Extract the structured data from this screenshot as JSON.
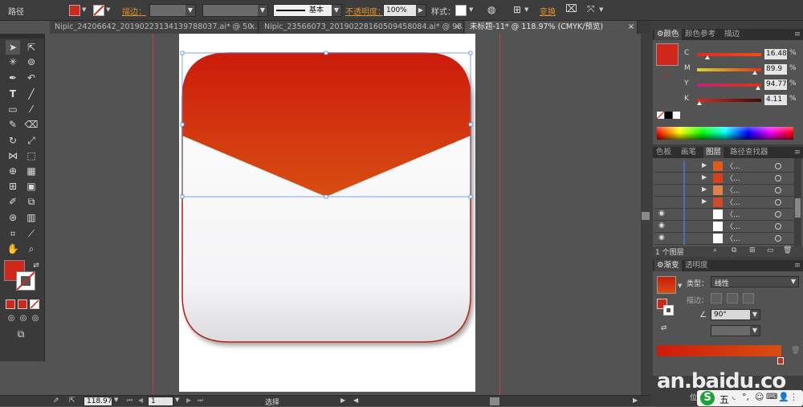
{
  "control_bar": {
    "object_label": "路径",
    "fill_color": "#d0271b",
    "stroke_label": "描边：",
    "stroke_profile": "基本",
    "opacity_label": "不透明度：",
    "opacity_value": "100%",
    "style_label": "样式：",
    "transform_label": "变换"
  },
  "tabs": [
    {
      "label": "Nipic_24206642_20190223134139788037.ai* @ 50...",
      "close": "×"
    },
    {
      "label": "Nipic_23566073_20190228160509458084.ai* @ 98...",
      "close": "×"
    },
    {
      "label": "未标题-11* @ 118.97% (CMYK/预览)",
      "close": "×"
    }
  ],
  "color_panel": {
    "tabs": [
      "颜色",
      "颜色参考",
      "描边"
    ],
    "sliders": [
      {
        "letter": "C",
        "value": "16.48",
        "unit": "%",
        "level": 0.16,
        "gradient": "linear-gradient(90deg,#e02a22,#f34c16)"
      },
      {
        "letter": "M",
        "value": "89.9",
        "unit": "%",
        "level": 0.9,
        "gradient": "linear-gradient(90deg,#d6d62c,#e03218)"
      },
      {
        "letter": "Y",
        "value": "94.77",
        "unit": "%",
        "level": 0.95,
        "gradient": "linear-gradient(90deg,#c1237c,#d93615)"
      },
      {
        "letter": "K",
        "value": "4.11",
        "unit": "%",
        "level": 0.04,
        "gradient": "linear-gradient(90deg,#dd2a1c,#3a0c09)"
      }
    ]
  },
  "layers_panel": {
    "tabs": [
      "色板",
      "画笔",
      "图层",
      "路径查找器"
    ],
    "rows": [
      {
        "eye": "",
        "arrow": "▶",
        "name": "〈...",
        "thumb": "#e05a1c"
      },
      {
        "eye": "",
        "arrow": "▶",
        "name": "〈...",
        "thumb": "#d6401e"
      },
      {
        "eye": "",
        "arrow": "▶",
        "name": "〈...",
        "thumb": "#e0804a"
      },
      {
        "eye": "",
        "arrow": "▶",
        "name": "〈...",
        "thumb": "#d04a2a"
      },
      {
        "eye": "◉",
        "arrow": "",
        "name": "〈...",
        "thumb": "#ffffff"
      },
      {
        "eye": "◉",
        "arrow": "",
        "name": "〈...",
        "thumb": "#ffffff"
      },
      {
        "eye": "◉",
        "arrow": "",
        "name": "〈...",
        "thumb": "#ffffff"
      }
    ],
    "footer": "1 个图层"
  },
  "gradient_panel": {
    "tabs": [
      "渐变",
      "透明度"
    ],
    "type_label": "类型：",
    "type_value": "线性",
    "stroke_label": "描边：",
    "angle_value": "90°",
    "location_label": "位置"
  },
  "status_bar": {
    "zoom": "118.97",
    "page": "1",
    "mode": "选择"
  },
  "watermark": {
    "text": "an.baidu.co"
  },
  "tray": {
    "ime": "五"
  },
  "colors": {
    "accent": "#d0271b",
    "panel_bg": "#535353",
    "dark_bg": "#3a3a3a"
  }
}
